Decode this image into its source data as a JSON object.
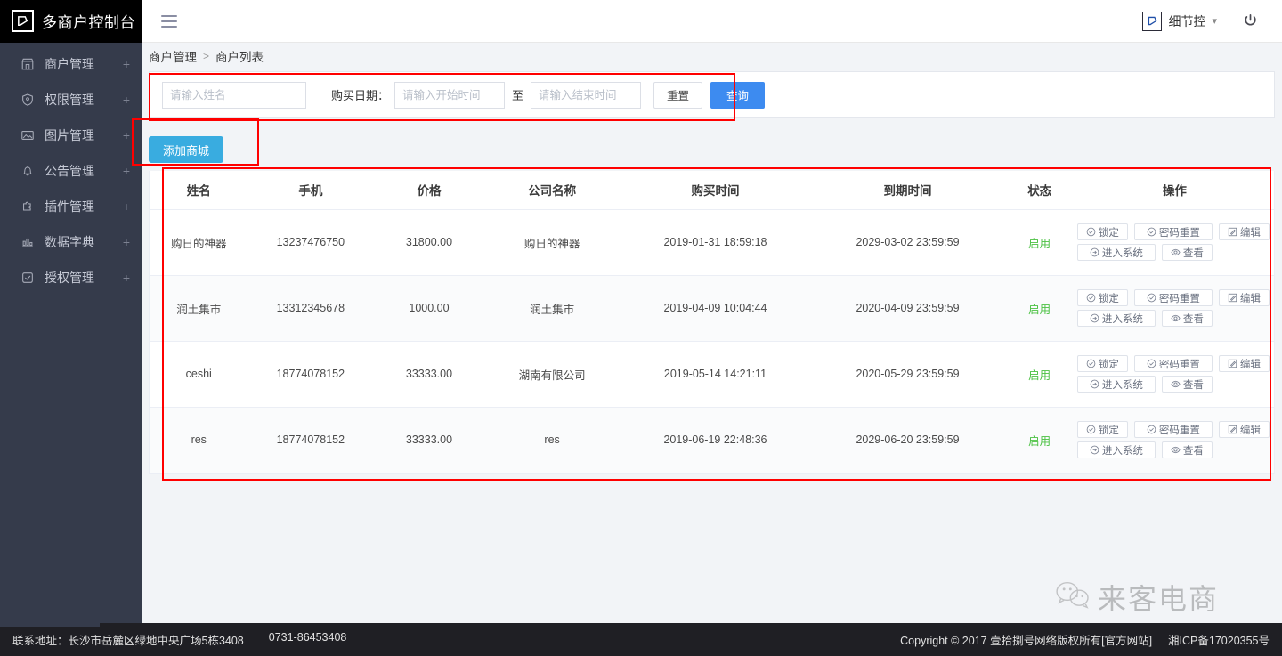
{
  "topbar": {
    "brand_title": "多商户控制台",
    "brand_logo_icon": "diamond-s-logo-icon",
    "menu_toggle_icon": "hamburger-icon",
    "user_name": "细节控",
    "user_avatar_icon": "diamond-s-logo-icon",
    "chevron_icon": "chevron-down-icon",
    "power_icon": "power-icon"
  },
  "sidebar": {
    "items": [
      {
        "label": "商户管理",
        "icon": "shop-icon",
        "expand": "+"
      },
      {
        "label": "权限管理",
        "icon": "shield-icon",
        "expand": "+"
      },
      {
        "label": "图片管理",
        "icon": "picture-icon",
        "expand": "+"
      },
      {
        "label": "公告管理",
        "icon": "bell-icon",
        "expand": "+"
      },
      {
        "label": "插件管理",
        "icon": "puzzle-icon",
        "expand": "+"
      },
      {
        "label": "数据字典",
        "icon": "bar-chart-icon",
        "expand": "+"
      },
      {
        "label": "授权管理",
        "icon": "check-square-icon",
        "expand": "+"
      }
    ]
  },
  "breadcrumb": {
    "parent": "商户管理",
    "separator": ">",
    "current": "商户列表"
  },
  "search": {
    "name_placeholder": "请输入姓名",
    "name_value": "",
    "date_label": "购买日期：",
    "start_placeholder": "请输入开始时间",
    "start_value": "",
    "to_label": "至",
    "end_placeholder": "请输入结束时间",
    "end_value": "",
    "reset_label": "重置",
    "query_label": "查询"
  },
  "toolbar": {
    "add_label": "添加商城"
  },
  "table": {
    "headers": [
      "姓名",
      "手机",
      "价格",
      "公司名称",
      "购买时间",
      "到期时间",
      "状态",
      "操作"
    ],
    "row_actions": [
      {
        "label": "锁定",
        "icon": "check-circle-icon",
        "width": "op-w1"
      },
      {
        "label": "密码重置",
        "icon": "check-circle-icon",
        "width": "op-w2"
      },
      {
        "label": "编辑",
        "icon": "edit-icon",
        "width": "op-w1"
      },
      {
        "label": "进入系统",
        "icon": "arrow-right-circle-icon",
        "width": "op-w2"
      },
      {
        "label": "查看",
        "icon": "eye-icon",
        "width": "op-w1"
      }
    ],
    "rows": [
      {
        "name": "购日的神器",
        "phone": "13237476750",
        "price": "31800.00",
        "company": "购日的神器",
        "buy_time": "2019-01-31 18:59:18",
        "expire_time": "2029-03-02 23:59:59",
        "status": "启用"
      },
      {
        "name": "润土集市",
        "phone": "13312345678",
        "price": "1000.00",
        "company": "润土集市",
        "buy_time": "2019-04-09 10:04:44",
        "expire_time": "2020-04-09 23:59:59",
        "status": "启用"
      },
      {
        "name": "ceshi",
        "phone": "18774078152",
        "price": "33333.00",
        "company": "湖南有限公司",
        "buy_time": "2019-05-14 14:21:11",
        "expire_time": "2020-05-29 23:59:59",
        "status": "启用"
      },
      {
        "name": "res",
        "phone": "18774078152",
        "price": "33333.00",
        "company": "res",
        "buy_time": "2019-06-19 22:48:36",
        "expire_time": "2029-06-20 23:59:59",
        "status": "启用"
      }
    ]
  },
  "watermark": {
    "text": "来客电商",
    "icon": "wechat-icon"
  },
  "footer": {
    "address": "联系地址：长沙市岳麓区绿地中央广场5栋3408",
    "phone": "0731-86453408",
    "copyright": "Copyright © 2017 壹拾捌号网络版权所有[官方网站]",
    "icp": "湘ICP备17020355号"
  },
  "colors": {
    "brand_black": "#000000",
    "sidebar_bg": "#353b4b",
    "primary_blue": "#3d8bf0",
    "add_blue": "#39ace0",
    "status_green": "#4cc144",
    "annotation_red": "#ff0000",
    "footer_bg": "#1f1f24"
  }
}
